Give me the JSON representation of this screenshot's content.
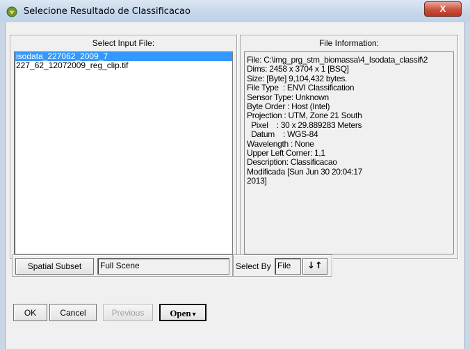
{
  "window": {
    "title": "Selecione Resultado de Classificacao",
    "close_label": "X"
  },
  "input_panel": {
    "title": "Select Input File:",
    "files": [
      {
        "name": "isodata_227062_2009_7",
        "selected": true
      },
      {
        "name": "227_62_12072009_reg_clip.tif",
        "selected": false
      }
    ]
  },
  "info_panel": {
    "title": "File Information:",
    "lines": [
      "File: C:\\img_prg_stm_biomassa\\4_Isodata_classif\\2",
      "Dims: 2458 x 3704 x 1 [BSQ]",
      "Size: [Byte] 9,104,432 bytes.",
      "File Type  : ENVI Classification",
      "Sensor Type: Unknown",
      "Byte Order : Host (Intel)",
      "Projection : UTM, Zone 21 South",
      "  Pixel    : 30 x 29.889283 Meters",
      "  Datum    : WGS-84",
      "Wavelength : None",
      "Upper Left Corner: 1,1",
      "Description: Classificacao",
      "Modificada [Sun Jun 30 20:04:17",
      "2013]"
    ]
  },
  "subset": {
    "button_label": "Spatial Subset",
    "value": "Full Scene"
  },
  "select_by": {
    "label": "Select By",
    "value": "File",
    "sort_icon": "sort-arrows-icon",
    "sort_glyph": "↓↑"
  },
  "buttons": {
    "ok": "OK",
    "cancel": "Cancel",
    "previous": "Previous",
    "open": "Open",
    "open_arrow": "▾"
  },
  "colors": {
    "selection": "#3399ff",
    "close_button": "#c8503c",
    "title_bar": "#c5d6ea"
  }
}
